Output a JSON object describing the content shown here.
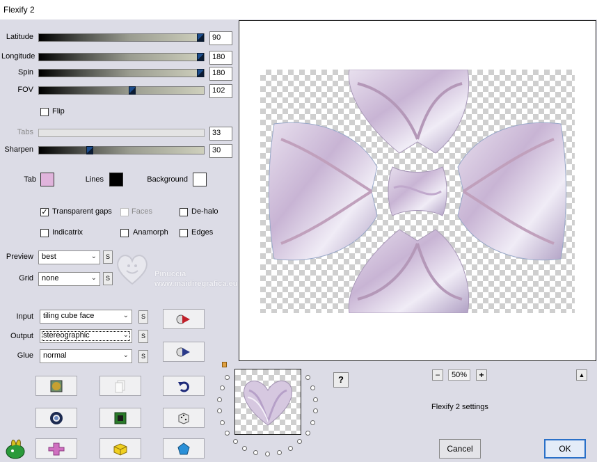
{
  "window": {
    "title": "Flexify 2"
  },
  "sliders": [
    {
      "key": "latitude",
      "label": "Latitude",
      "value": "90",
      "level": 1.0,
      "disabled": false
    },
    {
      "key": "longitude",
      "label": "Longitude",
      "value": "180",
      "level": 1.0,
      "disabled": false
    },
    {
      "key": "spin",
      "label": "Spin",
      "value": "180",
      "level": 1.0,
      "disabled": false
    },
    {
      "key": "fov",
      "label": "FOV",
      "value": "102",
      "level": 0.57,
      "disabled": false
    },
    {
      "key": "tabs",
      "label": "Tabs",
      "value": "33",
      "level": 0.0,
      "disabled": true
    },
    {
      "key": "sharpen",
      "label": "Sharpen",
      "value": "30",
      "level": 0.3,
      "disabled": false
    }
  ],
  "flip": {
    "label": "Flip",
    "checked": false
  },
  "colors": {
    "tab_label": "Tab",
    "tab_color": "#e0b4dc",
    "lines_label": "Lines",
    "lines_color": "#000000",
    "background_label": "Background",
    "background_color": "#ffffff"
  },
  "options": {
    "transparent_gaps": {
      "label": "Transparent gaps",
      "checked": true
    },
    "faces": {
      "label": "Faces",
      "checked": false,
      "disabled": true
    },
    "de_halo": {
      "label": "De-halo",
      "checked": false
    },
    "indicatrix": {
      "label": "Indicatrix",
      "checked": false
    },
    "anamorph": {
      "label": "Anamorph",
      "checked": false
    },
    "edges": {
      "label": "Edges",
      "checked": false
    }
  },
  "preview_select": {
    "label": "Preview",
    "value": "best"
  },
  "grid_select": {
    "label": "Grid",
    "value": "none"
  },
  "input_select": {
    "label": "Input",
    "value": "tiling cube face"
  },
  "output_select": {
    "label": "Output",
    "value": "stereographic"
  },
  "glue_select": {
    "label": "Glue",
    "value": "normal"
  },
  "s_button_label": "S",
  "watermark": {
    "line1": "Pinuccia",
    "line2": "www.maidiregrafica.eu"
  },
  "zoom": {
    "minus": "−",
    "value": "50%",
    "plus": "+"
  },
  "help_label": "?",
  "collapse_label": "▲",
  "settings_label": "Flexify 2 settings",
  "buttons": {
    "cancel": "Cancel",
    "ok": "OK"
  }
}
